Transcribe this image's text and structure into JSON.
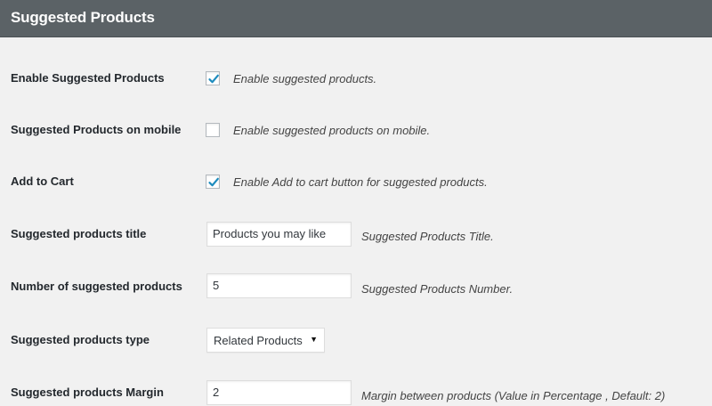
{
  "header": {
    "title": "Suggested Products"
  },
  "settings": {
    "enable": {
      "label": "Enable Suggested Products",
      "checked": true,
      "description": "Enable suggested products."
    },
    "mobile": {
      "label": "Suggested Products on mobile",
      "checked": false,
      "description": "Enable suggested products on mobile."
    },
    "add_to_cart": {
      "label": "Add to Cart",
      "checked": true,
      "description": "Enable Add to cart button for suggested products."
    },
    "title": {
      "label": "Suggested products title",
      "value": "Products you may like",
      "description": "Suggested Products Title."
    },
    "number": {
      "label": "Number of suggested products",
      "value": "5",
      "description": "Suggested Products Number."
    },
    "type": {
      "label": "Suggested products type",
      "selected": "Related Products"
    },
    "margin": {
      "label": "Suggested products Margin",
      "value": "2",
      "description": "Margin between products (Value in Percentage , Default: 2)"
    }
  },
  "colors": {
    "header_bg": "#5b6266",
    "checkmark": "#1e8cbe",
    "page_bg": "#f1f1f1"
  }
}
